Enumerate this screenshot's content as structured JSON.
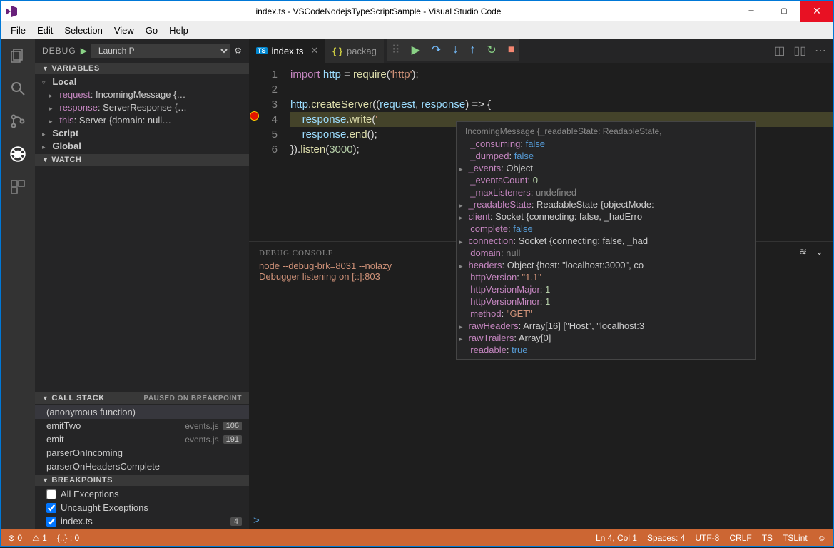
{
  "window": {
    "title": "index.ts - VSCodeNodejsTypeScriptSample - Visual Studio Code"
  },
  "menu": [
    "File",
    "Edit",
    "Selection",
    "View",
    "Go",
    "Help"
  ],
  "activity_icons": [
    "files-icon",
    "search-icon",
    "git-icon",
    "debug-icon",
    "extensions-icon"
  ],
  "debug_header": {
    "label": "DEBUG",
    "config": "Launch P"
  },
  "variables": {
    "title": "VARIABLES",
    "scopes": [
      {
        "name": "Local",
        "expanded": true,
        "items": [
          {
            "name": "request",
            "value": "IncomingMessage {…"
          },
          {
            "name": "response",
            "value": "ServerResponse {…"
          },
          {
            "name": "this",
            "value": "Server {domain: null…"
          }
        ]
      },
      {
        "name": "Script",
        "expanded": false
      },
      {
        "name": "Global",
        "expanded": false
      }
    ]
  },
  "watch": {
    "title": "WATCH"
  },
  "callstack": {
    "title": "CALL STACK",
    "status": "PAUSED ON BREAKPOINT",
    "frames": [
      {
        "fn": "(anonymous function)",
        "file": "",
        "line": "",
        "active": true
      },
      {
        "fn": "emitTwo",
        "file": "events.js",
        "line": "106"
      },
      {
        "fn": "emit",
        "file": "events.js",
        "line": "191"
      },
      {
        "fn": "parserOnIncoming",
        "file": "",
        "line": ""
      },
      {
        "fn": "parserOnHeadersComplete",
        "file": "",
        "line": ""
      }
    ]
  },
  "breakpoints": {
    "title": "BREAKPOINTS",
    "items": [
      {
        "label": "All Exceptions",
        "checked": false,
        "count": ""
      },
      {
        "label": "Uncaught Exceptions",
        "checked": true,
        "count": ""
      },
      {
        "label": "index.ts",
        "checked": true,
        "count": "4"
      }
    ]
  },
  "tabs": [
    {
      "name": "index.ts",
      "kind": "ts",
      "active": true
    },
    {
      "name": "packag",
      "kind": "json",
      "active": false
    }
  ],
  "editor": {
    "lines": [
      {
        "n": 1,
        "html": "<span class='tok-kw'>import</span> <span class='tok-var'>http</span> <span class='tok-punc'>=</span> <span class='tok-fn'>require</span><span class='tok-punc'>(</span><span class='tok-str'>'http'</span><span class='tok-punc'>);</span>"
      },
      {
        "n": 2,
        "html": ""
      },
      {
        "n": 3,
        "html": "<span class='tok-var'>http</span><span class='tok-punc'>.</span><span class='tok-fn'>createServer</span><span class='tok-punc'>((</span><span class='tok-var'>request</span><span class='tok-punc'>,</span> <span class='tok-var'>response</span><span class='tok-punc'>) =&gt; {</span>"
      },
      {
        "n": 4,
        "html": "    <span class='tok-var'>response</span><span class='tok-punc'>.</span><span class='tok-fn'>write</span><span class='tok-punc'>(</span><span class='tok-str'>'</span>",
        "hl": true,
        "bp": true
      },
      {
        "n": 5,
        "html": "    <span class='tok-var'>response</span><span class='tok-punc'>.</span><span class='tok-fn'>end</span><span class='tok-punc'>();</span>"
      },
      {
        "n": 6,
        "html": "<span class='tok-punc'>}).</span><span class='tok-fn'>listen</span><span class='tok-punc'>(</span><span class='tok-num'>3000</span><span class='tok-punc'>);</span>"
      }
    ]
  },
  "hover": {
    "title": "IncomingMessage {_readableState: ReadableState,",
    "rows": [
      {
        "name": "_consuming",
        "val": "false",
        "cls": "hp-bool"
      },
      {
        "name": "_dumped",
        "val": "false",
        "cls": "hp-bool"
      },
      {
        "name": "_events",
        "val": "Object",
        "cls": "hp-obj",
        "exp": true
      },
      {
        "name": "_eventsCount",
        "val": "0",
        "cls": "hp-num"
      },
      {
        "name": "_maxListeners",
        "val": "undefined",
        "cls": "hp-undef"
      },
      {
        "name": "_readableState",
        "val": "ReadableState {objectMode:",
        "cls": "hp-obj",
        "exp": true
      },
      {
        "name": "client",
        "val": "Socket {connecting: false, _hadErro",
        "cls": "hp-obj",
        "exp": true
      },
      {
        "name": "complete",
        "val": "false",
        "cls": "hp-bool"
      },
      {
        "name": "connection",
        "val": "Socket {connecting: false, _had",
        "cls": "hp-obj",
        "exp": true
      },
      {
        "name": "domain",
        "val": "null",
        "cls": "hp-undef"
      },
      {
        "name": "headers",
        "val": "Object {host: \"localhost:3000\", co",
        "cls": "hp-obj",
        "exp": true
      },
      {
        "name": "httpVersion",
        "val": "\"1.1\"",
        "cls": "hp-str"
      },
      {
        "name": "httpVersionMajor",
        "val": "1",
        "cls": "hp-num"
      },
      {
        "name": "httpVersionMinor",
        "val": "1",
        "cls": "hp-num"
      },
      {
        "name": "method",
        "val": "\"GET\"",
        "cls": "hp-str"
      },
      {
        "name": "rawHeaders",
        "val": "Array[16] [\"Host\", \"localhost:3",
        "cls": "hp-obj",
        "exp": true
      },
      {
        "name": "rawTrailers",
        "val": "Array[0]",
        "cls": "hp-obj",
        "exp": true
      },
      {
        "name": "readable",
        "val": "true",
        "cls": "hp-bool"
      }
    ]
  },
  "debug_console": {
    "title": "DEBUG CONSOLE",
    "lines": [
      "node --debug-brk=8031 --nolazy",
      "Debugger listening on [::]:803"
    ],
    "prompt": ">"
  },
  "statusbar": {
    "errors": "0",
    "warnings": "1",
    "fold": "{..} : 0",
    "pos": "Ln 4, Col 1",
    "spaces": "Spaces: 4",
    "enc": "UTF-8",
    "eol": "CRLF",
    "lang": "TS",
    "lint": "TSLint"
  }
}
